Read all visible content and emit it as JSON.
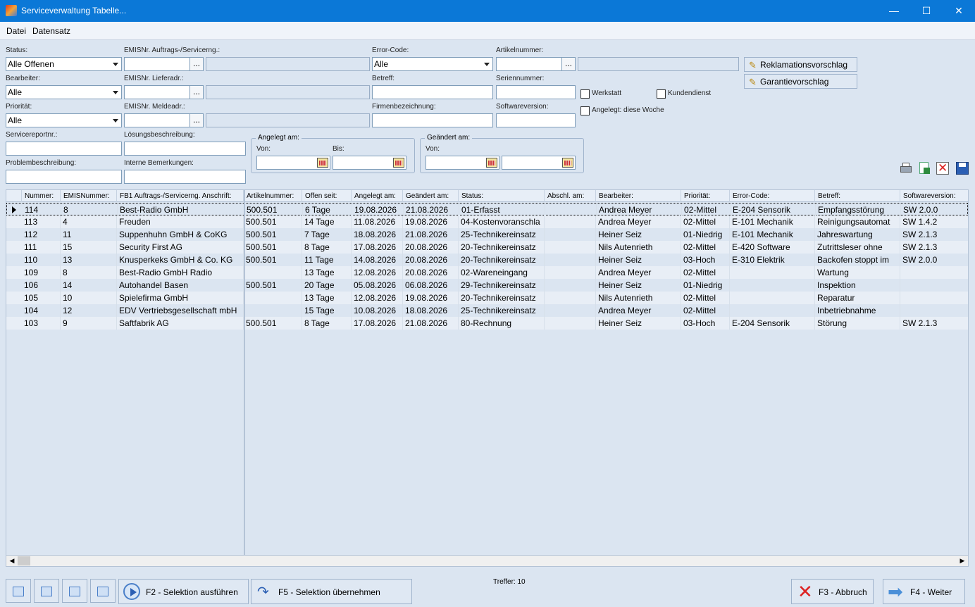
{
  "window": {
    "title": "Serviceverwaltung Tabelle...",
    "min": "—",
    "max": "☐",
    "close": "✕"
  },
  "menu": [
    "Datei",
    "Datensatz"
  ],
  "filters": {
    "status_label": "Status:",
    "status_value": "Alle Offenen",
    "emis_auftrag_label": "EMISNr. Auftrags-/Servicerng.:",
    "error_code_label": "Error-Code:",
    "error_code_value": "Alle",
    "artikel_label": "Artikelnummer:",
    "bearbeiter_label": "Bearbeiter:",
    "bearbeiter_value": "Alle",
    "emis_liefer_label": "EMISNr. Lieferadr.:",
    "betreff_label": "Betreff:",
    "serien_label": "Seriennummer:",
    "prioritaet_label": "Priorität:",
    "prioritaet_value": "Alle",
    "emis_melde_label": "EMISNr. Meldeadr.:",
    "firma_label": "Firmenbezeichnung:",
    "software_label": "Softwareversion:",
    "servicereport_label": "Servicereportnr.:",
    "loesung_label": "Lösungsbeschreibung:",
    "problem_label": "Problembeschreibung:",
    "intern_label": "Interne Bemerkungen:",
    "angelegt_group": "Angelegt am:",
    "geaendert_group": "Geändert am:",
    "von": "Von:",
    "bis": "Bis:",
    "werkstatt": "Werkstatt",
    "kundendienst": "Kundendienst",
    "diese_woche": "Angelegt: diese Woche",
    "dots": "..."
  },
  "buttons": {
    "reklamation": "Reklamationsvorschlag",
    "garantie": "Garantievorschlag",
    "f2": "F2 - Selektion ausführen",
    "f5": "F5 - Selektion übernehmen",
    "f3": "F3 - Abbruch",
    "f4": "F4 - Weiter"
  },
  "treffer": "Treffer: 10",
  "columns": [
    "Nummer:",
    "EMISNummer:",
    "FB1 Auftrags-/Servicerng. Anschrift:",
    "Artikelnummer:",
    "Offen seit:",
    "Angelegt am:",
    "Geändert am:",
    "Status:",
    "Abschl. am:",
    "Bearbeiter:",
    "Priorität:",
    "Error-Code:",
    "Betreff:",
    "Softwareversion:"
  ],
  "rows": [
    [
      "114",
      "8",
      "Best-Radio GmbH",
      "500.501",
      "6 Tage",
      "19.08.2026",
      "21.08.2026",
      "01-Erfasst",
      "",
      "Andrea Meyer",
      "02-Mittel",
      "E-204 Sensorik",
      "Empfangsstörung",
      "SW 2.0.0"
    ],
    [
      "113",
      "4",
      "Freuden",
      "500.501",
      "14 Tage",
      "11.08.2026",
      "19.08.2026",
      "04-Kostenvoranschla",
      "",
      "Andrea Meyer",
      "02-Mittel",
      "E-101 Mechanik",
      "Reinigungsautomat",
      "SW 1.4.2"
    ],
    [
      "112",
      "11",
      "Suppenhuhn GmbH & CoKG",
      "500.501",
      "7 Tage",
      "18.08.2026",
      "21.08.2026",
      "25-Technikereinsatz",
      "",
      "Heiner Seiz",
      "01-Niedrig",
      "E-101 Mechanik",
      "Jahreswartung",
      "SW 2.1.3"
    ],
    [
      "111",
      "15",
      "Security First AG",
      "500.501",
      "8 Tage",
      "17.08.2026",
      "20.08.2026",
      "20-Technikereinsatz",
      "",
      "Nils Autenrieth",
      "02-Mittel",
      "E-420 Software",
      "Zutrittsleser ohne",
      "SW 2.1.3"
    ],
    [
      "110",
      "13",
      "Knusperkeks GmbH & Co. KG",
      "500.501",
      "11 Tage",
      "14.08.2026",
      "20.08.2026",
      "20-Technikereinsatz",
      "",
      "Heiner Seiz",
      "03-Hoch",
      "E-310 Elektrik",
      "Backofen stoppt im",
      "SW 2.0.0"
    ],
    [
      "109",
      "8",
      "Best-Radio GmbH Radio",
      "",
      "13 Tage",
      "12.08.2026",
      "20.08.2026",
      "02-Wareneingang",
      "",
      "Andrea Meyer",
      "02-Mittel",
      "",
      "Wartung",
      ""
    ],
    [
      "106",
      "14",
      "Autohandel Basen",
      "500.501",
      "20 Tage",
      "05.08.2026",
      "06.08.2026",
      "29-Technikereinsatz",
      "",
      "Heiner Seiz",
      "01-Niedrig",
      "",
      "Inspektion",
      ""
    ],
    [
      "105",
      "10",
      "Spielefirma GmbH",
      "",
      "13 Tage",
      "12.08.2026",
      "19.08.2026",
      "20-Technikereinsatz",
      "",
      "Nils Autenrieth",
      "02-Mittel",
      "",
      "Reparatur",
      ""
    ],
    [
      "104",
      "12",
      "EDV Vertriebsgesellschaft mbH",
      "",
      "15 Tage",
      "10.08.2026",
      "18.08.2026",
      "25-Technikereinsatz",
      "",
      "Andrea Meyer",
      "02-Mittel",
      "",
      "Inbetriebnahme",
      ""
    ],
    [
      "103",
      "9",
      "Saftfabrik AG",
      "500.501",
      "8 Tage",
      "17.08.2026",
      "21.08.2026",
      "80-Rechnung",
      "",
      "Heiner Seiz",
      "03-Hoch",
      "E-204 Sensorik",
      "Störung",
      "SW 2.1.3"
    ]
  ]
}
